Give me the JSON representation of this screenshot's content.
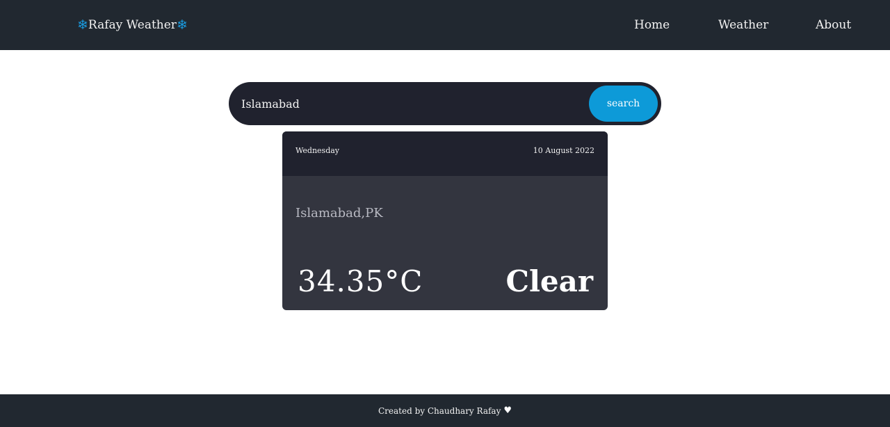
{
  "navbar": {
    "brand": {
      "name": "Rafay Weather",
      "left_icon": "snowflake-icon",
      "right_icon": "snowflake-icon",
      "icon_color": "#1a9be0"
    },
    "links": {
      "home": "Home",
      "weather": "Weather",
      "about": "About"
    }
  },
  "search": {
    "value": "Islamabad",
    "button_label": "search",
    "button_color": "#0d9ad8"
  },
  "card": {
    "day": "Wednesday",
    "date": "10 August 2022",
    "location": "Islamabad,PK",
    "temperature": "34.35°C",
    "condition": "Clear"
  },
  "footer": {
    "text": "Created by Chaudhary Rafay",
    "icon": "heart-icon"
  }
}
